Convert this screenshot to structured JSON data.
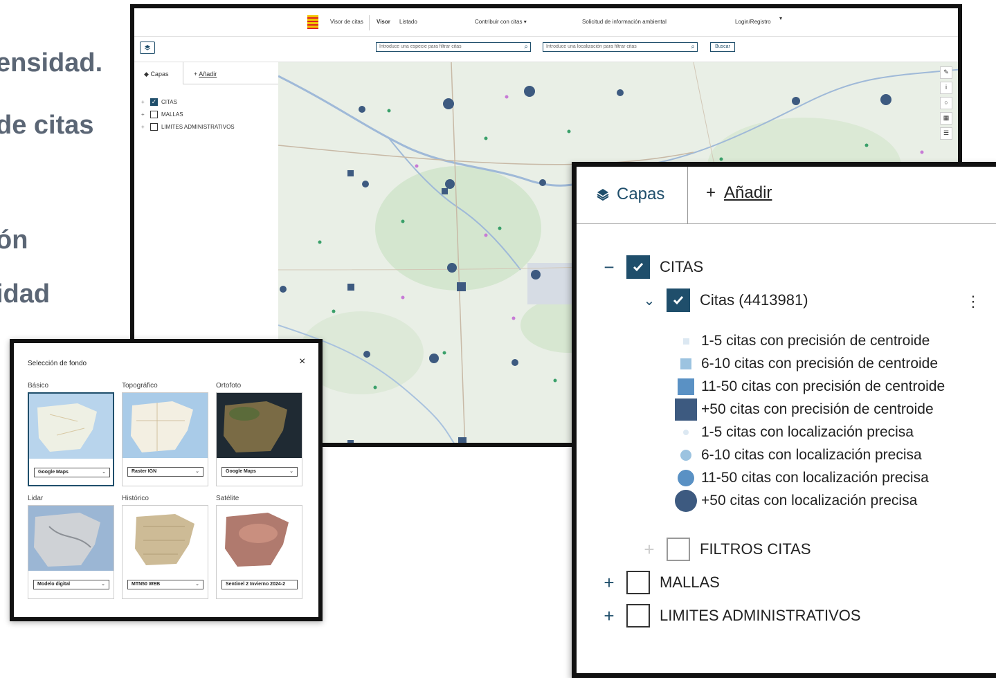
{
  "slide_fragments": [
    "ensidad.",
    "de citas",
    "ón",
    "idad"
  ],
  "topbar": {
    "visor_citas": "Visor de citas",
    "visor": "Visor",
    "listado": "Listado",
    "contribuir": "Contribuir con citas",
    "solicitud": "Solicitud de información ambiental",
    "login": "Login/Registro"
  },
  "search": {
    "species_placeholder": "Introduce una especie para filtrar citas",
    "location_placeholder": "Introduce una localización para filtrar citas",
    "button": "Buscar"
  },
  "sidebar": {
    "tab_capas": "Capas",
    "tab_anadir": "Añadir",
    "layers": [
      {
        "label": "CITAS",
        "checked": true
      },
      {
        "label": "MALLAS",
        "checked": false
      },
      {
        "label": "LIMITES ADMINISTRATIVOS",
        "checked": false
      }
    ]
  },
  "fondo": {
    "title": "Selección de fondo",
    "close": "×",
    "options": [
      {
        "group": "Básico",
        "select": "Google Maps",
        "selected": true
      },
      {
        "group": "Topográfico",
        "select": "Raster IGN",
        "selected": false
      },
      {
        "group": "Ortofoto",
        "select": "Google Maps",
        "selected": false
      },
      {
        "group": "Lidar",
        "select": "Modelo digital",
        "selected": false
      },
      {
        "group": "Histórico",
        "select": "MTN50 WEB",
        "selected": false
      },
      {
        "group": "Satélite",
        "select": "Sentinel 2 Invierno 2024-2",
        "selected": false
      }
    ]
  },
  "zoom_panel": {
    "tab_capas": "Capas",
    "tab_anadir": "Añadir",
    "citas_group": "CITAS",
    "citas_layer": "Citas (4413981)",
    "legend": [
      "1-5 citas con precisión de centroide",
      "6-10 citas con precisión de centroide",
      "11-50 citas con precisión de centroide",
      "+50 citas con precisión de centroide",
      "1-5 citas con localización precisa",
      "6-10 citas con localización precisa",
      "11-50 citas con localización precisa",
      "+50 citas con localización precisa"
    ],
    "filtros": "FILTROS CITAS",
    "mallas": "MALLAS",
    "limites": "LIMITES ADMINISTRATIVOS"
  },
  "colors": {
    "accent": "#1f4e6b",
    "marker_dark": "#3d5a80",
    "marker_light": "#8fb8d8"
  }
}
